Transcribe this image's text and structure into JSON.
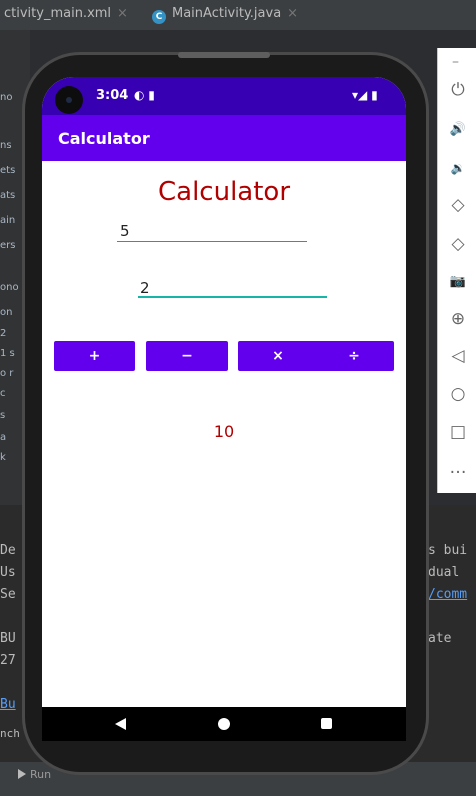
{
  "ide": {
    "tabs": [
      {
        "label": "ctivity_main.xml",
        "close": "×"
      },
      {
        "label": "MainActivity.java",
        "close": "×"
      }
    ],
    "sidebar_snippets": [
      "no",
      "ns",
      "ets",
      "ats",
      "ain",
      "ers",
      "ono",
      "on",
      "2",
      "1 s",
      "o r",
      "c",
      "s",
      "a",
      "k"
    ],
    "console": {
      "left": [
        "De",
        "Us",
        "Se",
        "",
        "BU",
        "27",
        "",
        "Bu",
        "nch"
      ],
      "right": [
        "s bui",
        "dual",
        "/comm",
        "",
        "",
        "ate"
      ]
    },
    "run_tab": "Run"
  },
  "emulator_toolbar": {
    "minimize": "–",
    "buttons": [
      "power-icon",
      "volume-up-icon",
      "volume-down-icon",
      "rotate-left-icon",
      "rotate-right-icon",
      "camera-icon",
      "zoom-icon",
      "back-icon",
      "home-icon",
      "overview-icon",
      "more-icon"
    ],
    "glyphs": [
      "⏻",
      "🔊",
      "🔉",
      "◇",
      "◇",
      "📷",
      "⊕",
      "◁",
      "○",
      "□",
      "…"
    ]
  },
  "device": {
    "status_time": "3:04",
    "status_icons_left": "◐ ▮",
    "status_icons_right": "▾◢ ▮",
    "app_title": "Calculator",
    "heading": "Calculator",
    "input1_value": "5",
    "input2_value": "2",
    "buttons": [
      "+",
      "−",
      "×",
      "÷"
    ],
    "result": "10"
  },
  "colors": {
    "status_bar": "#3700b3",
    "app_bar": "#6200ee",
    "button": "#6200ee",
    "heading_text": "#b00000",
    "active_underline": "#17b5a8"
  }
}
